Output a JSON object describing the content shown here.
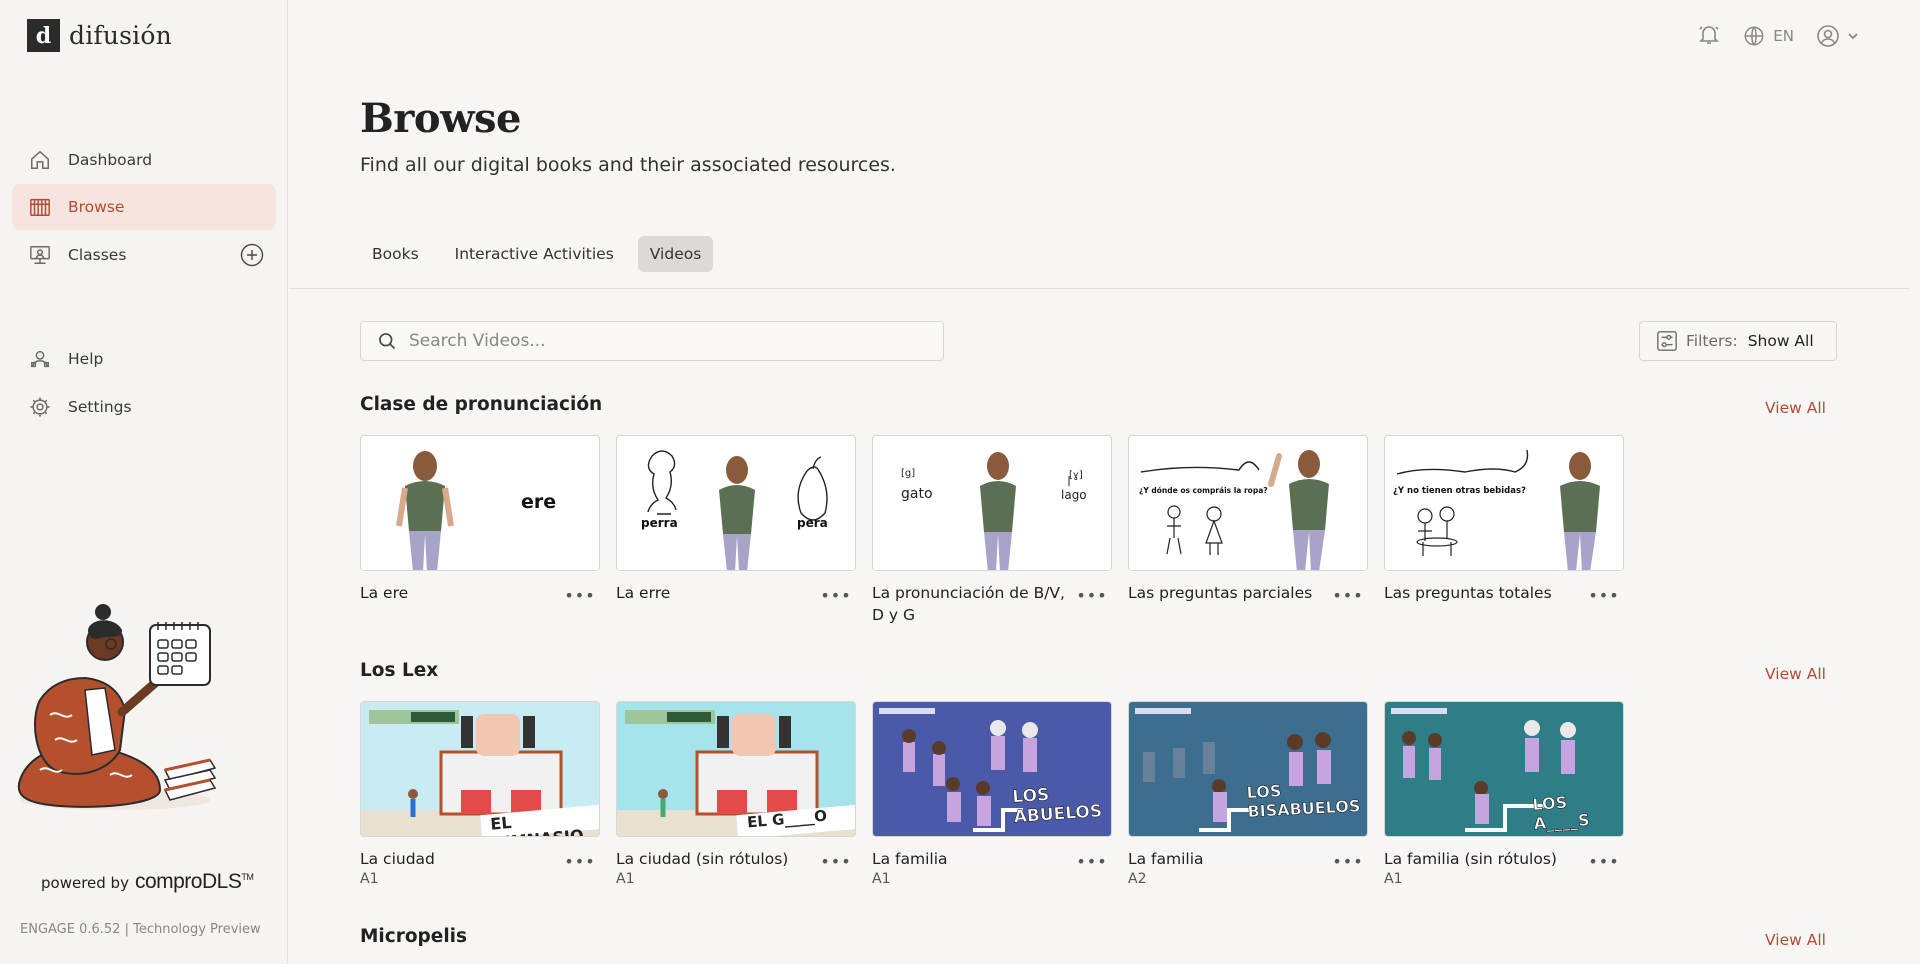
{
  "brand": {
    "logo_mark": "d",
    "name": "difusión"
  },
  "sidebar": {
    "items": [
      {
        "label": "Dashboard",
        "icon": "home-icon"
      },
      {
        "label": "Browse",
        "icon": "library-icon",
        "active": true
      },
      {
        "label": "Classes",
        "icon": "classroom-icon"
      },
      {
        "label": "Help",
        "icon": "help-icon"
      },
      {
        "label": "Settings",
        "icon": "gear-icon"
      }
    ],
    "powered_by": "powered by",
    "powered_brand": "comproDLS",
    "trademark": "TM",
    "version": "ENGAGE 0.6.52 | Technology Preview"
  },
  "topbar": {
    "language": "EN"
  },
  "page": {
    "title": "Browse",
    "subtitle": "Find all our digital books and their associated resources."
  },
  "tabs": [
    {
      "label": "Books"
    },
    {
      "label": "Interactive Activities"
    },
    {
      "label": "Videos",
      "active": true
    }
  ],
  "search": {
    "placeholder": "Search Videos..."
  },
  "filters": {
    "label": "Filters:",
    "value": "Show All"
  },
  "sections": [
    {
      "title": "Clase de pronunciación",
      "view_all": "View All",
      "cards": [
        {
          "title": "La ere",
          "thumb_text": "ere"
        },
        {
          "title": "La erre",
          "thumb_text_left": "perra",
          "thumb_text_right": "pera"
        },
        {
          "title": "La pronunciación de B/V, D y G",
          "thumb_text_left": "gato",
          "thumb_text_right": "lago",
          "phon_left": "[g]",
          "phon_right": "[ɣ]"
        },
        {
          "title": "Las preguntas parciales",
          "thumb_text": "¿Y dónde os compráis la ropa?"
        },
        {
          "title": "Las preguntas totales",
          "thumb_text": "¿Y no tienen otras bebidas?"
        }
      ]
    },
    {
      "title": "Los Lex",
      "view_all": "View All",
      "cards": [
        {
          "title": "La ciudad",
          "level": "A1",
          "thumb_text": "EL GIMNASIO"
        },
        {
          "title": "La ciudad (sin rótulos)",
          "level": "A1",
          "thumb_text": "EL G____O"
        },
        {
          "title": "La familia",
          "level": "A1",
          "thumb_text": "LOS ABUELOS"
        },
        {
          "title": "La familia",
          "level": "A2",
          "thumb_text": "LOS BISABUELOS"
        },
        {
          "title": "La familia (sin rótulos)",
          "level": "A1",
          "thumb_text": "LOS A____S"
        }
      ]
    },
    {
      "title": "Micropelis",
      "view_all": "View All"
    }
  ],
  "colors": {
    "accent": "#b24b35",
    "active_bg": "#f6e4df",
    "page_bg": "#f8f6f4"
  }
}
